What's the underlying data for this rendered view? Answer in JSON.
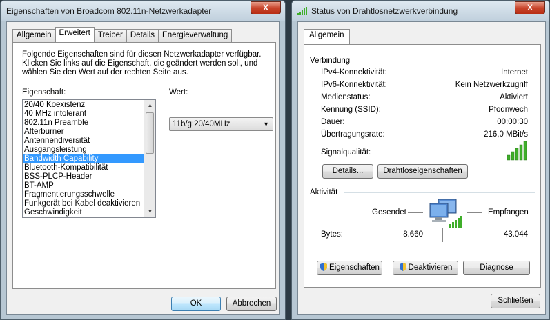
{
  "left_window": {
    "title": "Eigenschaften von Broadcom 802.11n-Netzwerkadapter",
    "close_label": "X",
    "tabs": [
      "Allgemein",
      "Erweitert",
      "Treiber",
      "Details",
      "Energieverwaltung"
    ],
    "active_tab": "Erweitert",
    "description": "Folgende Eigenschaften sind für diesen Netzwerkadapter verfügbar. Klicken Sie links auf die Eigenschaft, die geändert werden soll, und wählen Sie den Wert auf der rechten Seite aus.",
    "property_label": "Eigenschaft:",
    "value_label": "Wert:",
    "properties": [
      "20/40 Koexistenz",
      "40 MHz intolerant",
      "802.11n Preamble",
      "Afterburner",
      "Antennendiversität",
      "Ausgangsleistung",
      "Bandwidth Capability",
      "Bluetooth-Kompatibilität",
      "BSS-PLCP-Header",
      "BT-AMP",
      "Fragmentierungsschwelle",
      "Funkgerät bei Kabel deaktivieren",
      "Geschwindigkeit"
    ],
    "selected_property": "Bandwidth Capability",
    "value": "11b/g:20/40MHz",
    "ok_label": "OK",
    "cancel_label": "Abbrechen"
  },
  "right_window": {
    "title": "Status von Drahtlosnetzwerkverbindung",
    "close_label": "X",
    "tabs": [
      "Allgemein"
    ],
    "connection_group": "Verbindung",
    "rows": [
      {
        "label": "IPv4-Konnektivität:",
        "value": "Internet"
      },
      {
        "label": "IPv6-Konnektivität:",
        "value": "Kein Netzwerkzugriff"
      },
      {
        "label": "Medienstatus:",
        "value": "Aktiviert"
      },
      {
        "label": "Kennung (SSID):",
        "value": "Pfodnwech"
      },
      {
        "label": "Dauer:",
        "value": "00:00:30"
      },
      {
        "label": "Übertragungsrate:",
        "value": "216,0 MBit/s"
      }
    ],
    "signal_label": "Signalqualität:",
    "signal_bars": 5,
    "details_label": "Details...",
    "wireless_props_label": "Drahtloseigenschaften",
    "activity_group": "Aktivität",
    "sent_label": "Gesendet",
    "received_label": "Empfangen",
    "bytes_label": "Bytes:",
    "bytes_sent": "8.660",
    "bytes_received": "43.044",
    "properties_label": "Eigenschaften",
    "deactivate_label": "Deaktivieren",
    "diagnose_label": "Diagnose",
    "close_button_label": "Schließen"
  },
  "colors": {
    "selection": "#3399ff",
    "signal_green": "#3fae2a",
    "close_red": "#c8452c"
  }
}
